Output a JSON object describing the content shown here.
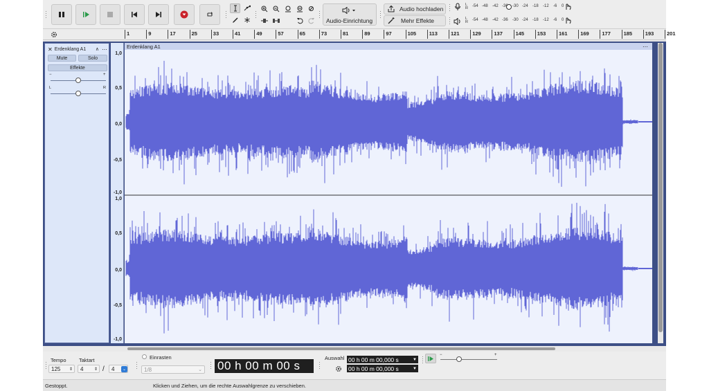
{
  "toolbar": {
    "audio_setup_label": "Audio-Einrichtung",
    "upload_label": "Audio hochladen",
    "more_effects_label": "Mehr Effekte",
    "meter_l": "L",
    "meter_r": "R",
    "meter_ticks": [
      "-54",
      "-48",
      "-42",
      "-36",
      "-30",
      "-24",
      "-18",
      "-12",
      "-6",
      "0"
    ]
  },
  "ruler": {
    "ticks": [
      "1",
      "9",
      "17",
      "25",
      "33",
      "41",
      "49",
      "57",
      "65",
      "73",
      "81",
      "89",
      "97",
      "105",
      "113",
      "121",
      "129",
      "137",
      "145",
      "153",
      "161",
      "169",
      "177",
      "185",
      "193",
      "201"
    ]
  },
  "track": {
    "name": "Erdenklang A1",
    "clip_name": "Erdenklang A1",
    "mute_label": "Mute",
    "solo_label": "Solo",
    "effects_label": "Effekte",
    "gain_minus": "−",
    "gain_plus": "+",
    "pan_l": "L",
    "pan_r": "R",
    "gain_level": 0.5,
    "pan_level": 0.5,
    "scale": [
      "1,0",
      "0,5",
      "0,0",
      "-0,5",
      "-1,0",
      "1,0",
      "0,5",
      "0,0",
      "-0,5",
      "-1,0"
    ],
    "wave_color": "#6066d6"
  },
  "bottom": {
    "tempo_label": "Tempo",
    "tempo_value": "125",
    "timesig_label": "Taktart",
    "timesig_num": "4",
    "timesig_sep": "/",
    "timesig_den": "4",
    "snap_label": "Einrasten",
    "snap_value": "1/8",
    "time_display": "00 h 00 m 00 s",
    "selection_label": "Auswahl",
    "sel_start": "00 h 00 m 00,000 s",
    "sel_end": "00 h 00 m 00,000 s",
    "play_speed_minus": "−",
    "play_speed_plus": "+"
  },
  "status": {
    "state": "Gestoppt.",
    "hint": "Klicken und Ziehen, um die rechte Auswahlgrenze zu verschieben."
  }
}
